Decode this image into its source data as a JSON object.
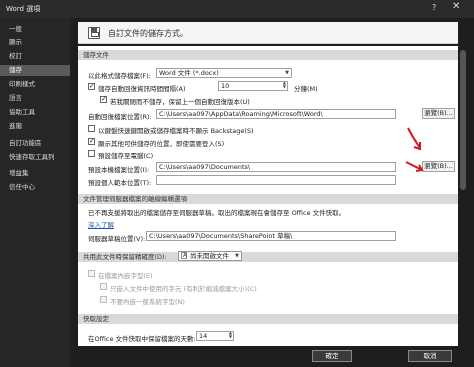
{
  "window": {
    "title": "Word 選項",
    "help": "?",
    "close": "✕"
  },
  "sidebar": {
    "items": [
      {
        "label": "一般"
      },
      {
        "label": "顯示"
      },
      {
        "label": "校訂"
      },
      {
        "label": "儲存",
        "active": true
      },
      {
        "label": "印刷樣式"
      },
      {
        "label": "語言"
      },
      {
        "label": "協助工具"
      },
      {
        "label": "進階"
      },
      {
        "label": "自訂功能區"
      },
      {
        "label": "快速存取工具列"
      },
      {
        "label": "增益集"
      },
      {
        "label": "信任中心"
      }
    ]
  },
  "header": {
    "title": "自訂文件的儲存方式。"
  },
  "save_docs": {
    "section_title": "儲存文件",
    "format_label": "以此格式儲存檔案(F):",
    "format_value": "Word 文件 (*.docx)",
    "autorecover_label": "儲存自動回復資訊時間間隔(A)",
    "autorecover_value": "10",
    "autorecover_unit": "分鐘(M)",
    "keep_last_label": "若我關閉而不儲存，保留上一個自動回復版本(U)",
    "autorecover_loc_label": "自動回復檔案位置(R):",
    "autorecover_loc_value": "C:\\Users\\aa097\\AppData\\Roaming\\Microsoft\\Word\\",
    "browse1": "瀏覽(B)...",
    "no_backstage_label": "以鍵盤快速鍵開啟或儲存檔案時不顯示 Backstage(S)",
    "show_more_label": "顯示其他可供儲存的位置，即使需要登入(S)",
    "default_computer_label": "預設儲存至電腦(C)",
    "default_local_label": "預設本機檔案位置(I):",
    "default_local_value": "C:\\Users\\aa097\\Documents\\",
    "browse2": "瀏覽(B)...",
    "personal_template_label": "預設個人範本位置(T):"
  },
  "offline": {
    "section_title": "文件管理伺服器檔案的離線編輯選項",
    "info_text": "已不再支援將取出的檔案儲存至伺服器草稿。取出的檔案現在會儲存至 Office 文件快取。",
    "learn_more": "深入了解",
    "drafts_label": "伺服器草稿位置(V):",
    "drafts_value": "C:\\Users\\aa097\\Documents\\SharePoint 草稿\\"
  },
  "fidelity": {
    "section_title": "共用此文件時保留精確度(D):",
    "doc_value": "尚未開啟文件",
    "embed_fonts_label": "在檔案內嵌字型(E)",
    "embed_used_label": "只嵌入文件中使用的字元 (有利於縮減檔案大小)(C)",
    "no_common_label": "不要內嵌一般系統字型(N)"
  },
  "cache": {
    "section_title": "快取設定",
    "days_label": "在Office 文件快取中保留檔案的天數:",
    "days_value": "14"
  },
  "footer": {
    "ok": "確定",
    "cancel": "取消"
  },
  "colors": {
    "accent_red": "#d01b1b",
    "selected_nav": "#5a5a5a"
  }
}
